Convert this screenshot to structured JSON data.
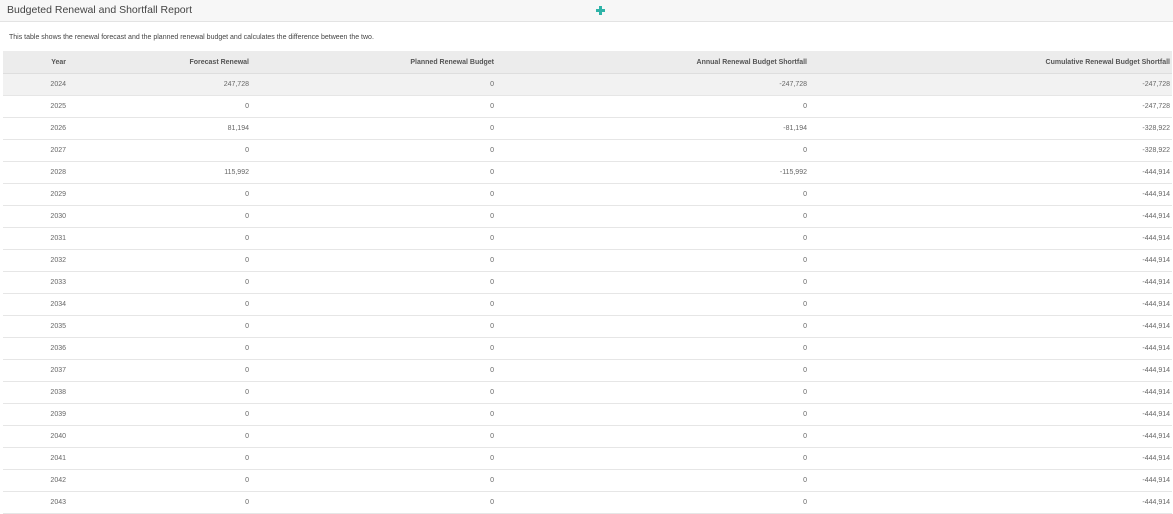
{
  "panel": {
    "title": "Budgeted Renewal and Shortfall Report",
    "add_icon": "plus-icon",
    "accent_color": "#2fb3a8"
  },
  "description": "This table shows the renewal forecast and the planned renewal budget and calculates the difference between the two.",
  "table": {
    "columns": [
      "Year",
      "Forecast Renewal",
      "Planned Renewal Budget",
      "Annual Renewal Budget Shortfall",
      "Cumulative Renewal Budget Shortfall"
    ],
    "rows": [
      [
        "2024",
        "247,728",
        "0",
        "-247,728",
        "-247,728"
      ],
      [
        "2025",
        "0",
        "0",
        "0",
        "-247,728"
      ],
      [
        "2026",
        "81,194",
        "0",
        "-81,194",
        "-328,922"
      ],
      [
        "2027",
        "0",
        "0",
        "0",
        "-328,922"
      ],
      [
        "2028",
        "115,992",
        "0",
        "-115,992",
        "-444,914"
      ],
      [
        "2029",
        "0",
        "0",
        "0",
        "-444,914"
      ],
      [
        "2030",
        "0",
        "0",
        "0",
        "-444,914"
      ],
      [
        "2031",
        "0",
        "0",
        "0",
        "-444,914"
      ],
      [
        "2032",
        "0",
        "0",
        "0",
        "-444,914"
      ],
      [
        "2033",
        "0",
        "0",
        "0",
        "-444,914"
      ],
      [
        "2034",
        "0",
        "0",
        "0",
        "-444,914"
      ],
      [
        "2035",
        "0",
        "0",
        "0",
        "-444,914"
      ],
      [
        "2036",
        "0",
        "0",
        "0",
        "-444,914"
      ],
      [
        "2037",
        "0",
        "0",
        "0",
        "-444,914"
      ],
      [
        "2038",
        "0",
        "0",
        "0",
        "-444,914"
      ],
      [
        "2039",
        "0",
        "0",
        "0",
        "-444,914"
      ],
      [
        "2040",
        "0",
        "0",
        "0",
        "-444,914"
      ],
      [
        "2041",
        "0",
        "0",
        "0",
        "-444,914"
      ],
      [
        "2042",
        "0",
        "0",
        "0",
        "-444,914"
      ],
      [
        "2043",
        "0",
        "0",
        "0",
        "-444,914"
      ]
    ]
  }
}
